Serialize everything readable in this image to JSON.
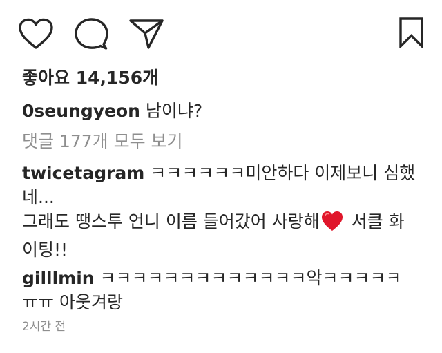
{
  "actions": {
    "like_icon": "heart-outline",
    "comment_icon": "speech-bubble",
    "share_icon": "paper-plane",
    "save_icon": "bookmark"
  },
  "likes": {
    "text": "좋아요 14,156개"
  },
  "caption": {
    "username": "0seungyeon",
    "text": "남이냐?"
  },
  "view_all_comments": "댓글 177개 모두 보기",
  "comments": [
    {
      "username": "twicetagram",
      "line1_text": "ㅋㅋㅋㅋㅋㅋ미안하다 이제보니 심했",
      "line2_text": "네...",
      "line3_text": "그래도 땡스투 언니 이름 들어갔어 사랑해",
      "line3_after": "서클 화",
      "line4_text": "이팅!!"
    },
    {
      "username": "gilllmin",
      "line1_text": "ㅋㅋㅋㅋㅋㅋㅋㅋㅋㅋㅋㅋㅋ악ㅋㅋㅋㅋㅋ",
      "line2_text": "ㅠㅠ 아웃겨랑"
    }
  ],
  "timestamp": "2시간 전",
  "colors": {
    "text": "#262626",
    "muted": "#8e8e8e",
    "heart_emoji": "#e0162b"
  }
}
